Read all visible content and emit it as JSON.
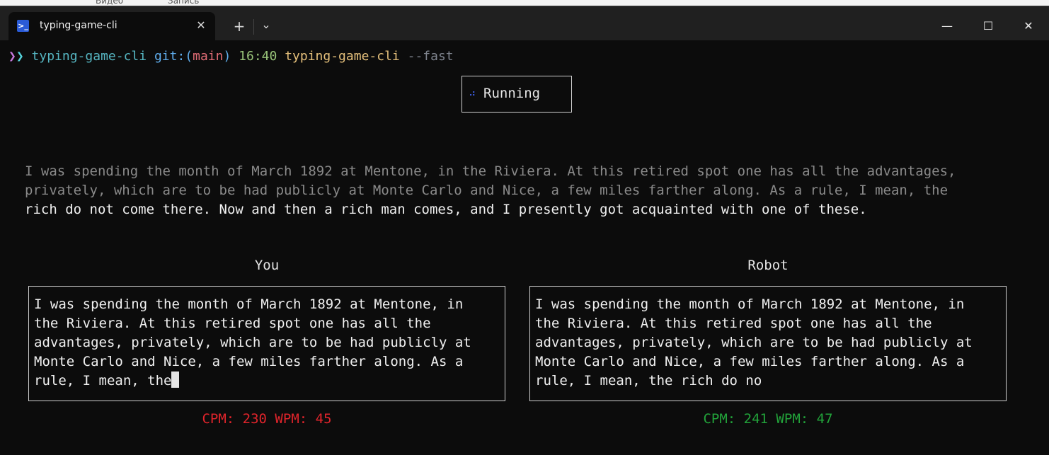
{
  "background": {
    "crumbs": [
      "Видео",
      "Запись"
    ]
  },
  "window": {
    "tab_title": "typing-game-cli",
    "tab_icon": "powershell-icon",
    "new_tab_label": "+",
    "dropdown_label": "⌄",
    "close_tab_label": "✕",
    "controls": {
      "minimize": "—",
      "maximize": "☐",
      "close": "✕"
    }
  },
  "prompt": {
    "arrows_1": "❯",
    "arrows_2": "❯",
    "dir": "typing-game-cli",
    "git_prefix": "git:(",
    "branch": "main",
    "git_suffix": ")",
    "time": "16:40",
    "command": "typing-game-cli",
    "flag": "--fast"
  },
  "status": {
    "spinner": "⠴",
    "text": "Running"
  },
  "passage": {
    "line1_done": "I was spending the month of March 1892 at Mentone, in the Riviera. At this retired spot one has all the advantages,",
    "line2_done": "privately, which are to be had publicly at Monte Carlo and Nice, a few miles farther along. As a rule, I mean, the",
    "line3_todo": "rich do not come there. Now and then a rich man comes, and I presently got acquainted with one of these."
  },
  "you": {
    "label": "You",
    "lines": [
      "I was spending the month of March 1892 at Mentone, in",
      "the Riviera. At this retired spot one has all the",
      "advantages, privately, which are to be had publicly at",
      "Monte Carlo and Nice, a few miles farther along. As a",
      "rule, I mean, the"
    ],
    "stats": "CPM: 230 WPM: 45",
    "stats_color": "#e0242b"
  },
  "robot": {
    "label": "Robot",
    "lines": [
      "I was spending the month of March 1892 at Mentone, in",
      "the Riviera. At this retired spot one has all the",
      "advantages, privately, which are to be had publicly at",
      "Monte Carlo and Nice, a few miles farther along. As a",
      "rule, I mean, the rich do no"
    ],
    "stats": "CPM: 241 WPM: 47",
    "stats_color": "#22a33a"
  }
}
